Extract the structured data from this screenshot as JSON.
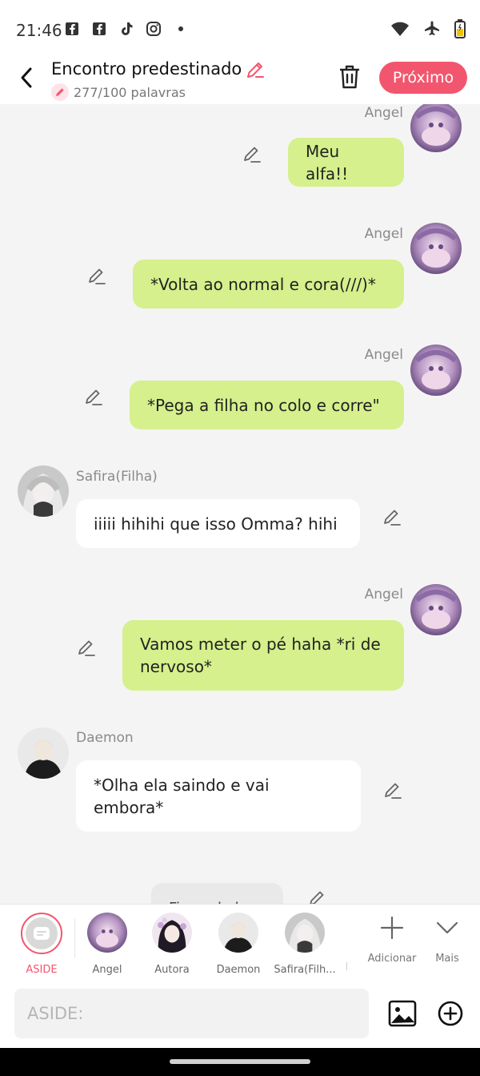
{
  "status": {
    "time": "21:46",
    "left_icons": [
      "facebook-icon",
      "facebook-icon",
      "tiktok-icon",
      "instagram-icon",
      "dot-icon"
    ],
    "right_icons": [
      "wifi-icon",
      "airplane-icon",
      "battery-icon"
    ]
  },
  "header": {
    "title": "Encontro predestinado",
    "word_count": "277/100 palavras",
    "next_label": "Próximo",
    "accent": "#f2566e"
  },
  "messages": [
    {
      "side": "right",
      "name": "Angel",
      "text": "Meu alfa!!"
    },
    {
      "side": "right",
      "name": "Angel",
      "text": "*Volta ao normal e cora(///)*"
    },
    {
      "side": "right",
      "name": "Angel",
      "text": "*Pega a filha no colo e corre\""
    },
    {
      "side": "left",
      "name": "Safira(Filha)",
      "text": "iiiii hihihi que isso Omma? hihi"
    },
    {
      "side": "right",
      "name": "Angel",
      "text": "Vamos meter o pé haha *ri de nervoso*"
    },
    {
      "side": "left",
      "name": "Daemon",
      "text": "*Olha ela saindo e vai embora*"
    },
    {
      "side": "center",
      "name": "",
      "text": "Fim... do l..."
    }
  ],
  "characters": {
    "aside": "ASIDE",
    "list": [
      "Angel",
      "Autora",
      "Daemon",
      "Safira(Filh..."
    ]
  },
  "tools": {
    "add_label": "Adicionar",
    "more_label": "Mais"
  },
  "input": {
    "placeholder": "ASIDE:"
  },
  "colors": {
    "green_bubble": "#d5f08c",
    "white_bubble": "#ffffff",
    "chat_bg": "#f4f4f4"
  }
}
